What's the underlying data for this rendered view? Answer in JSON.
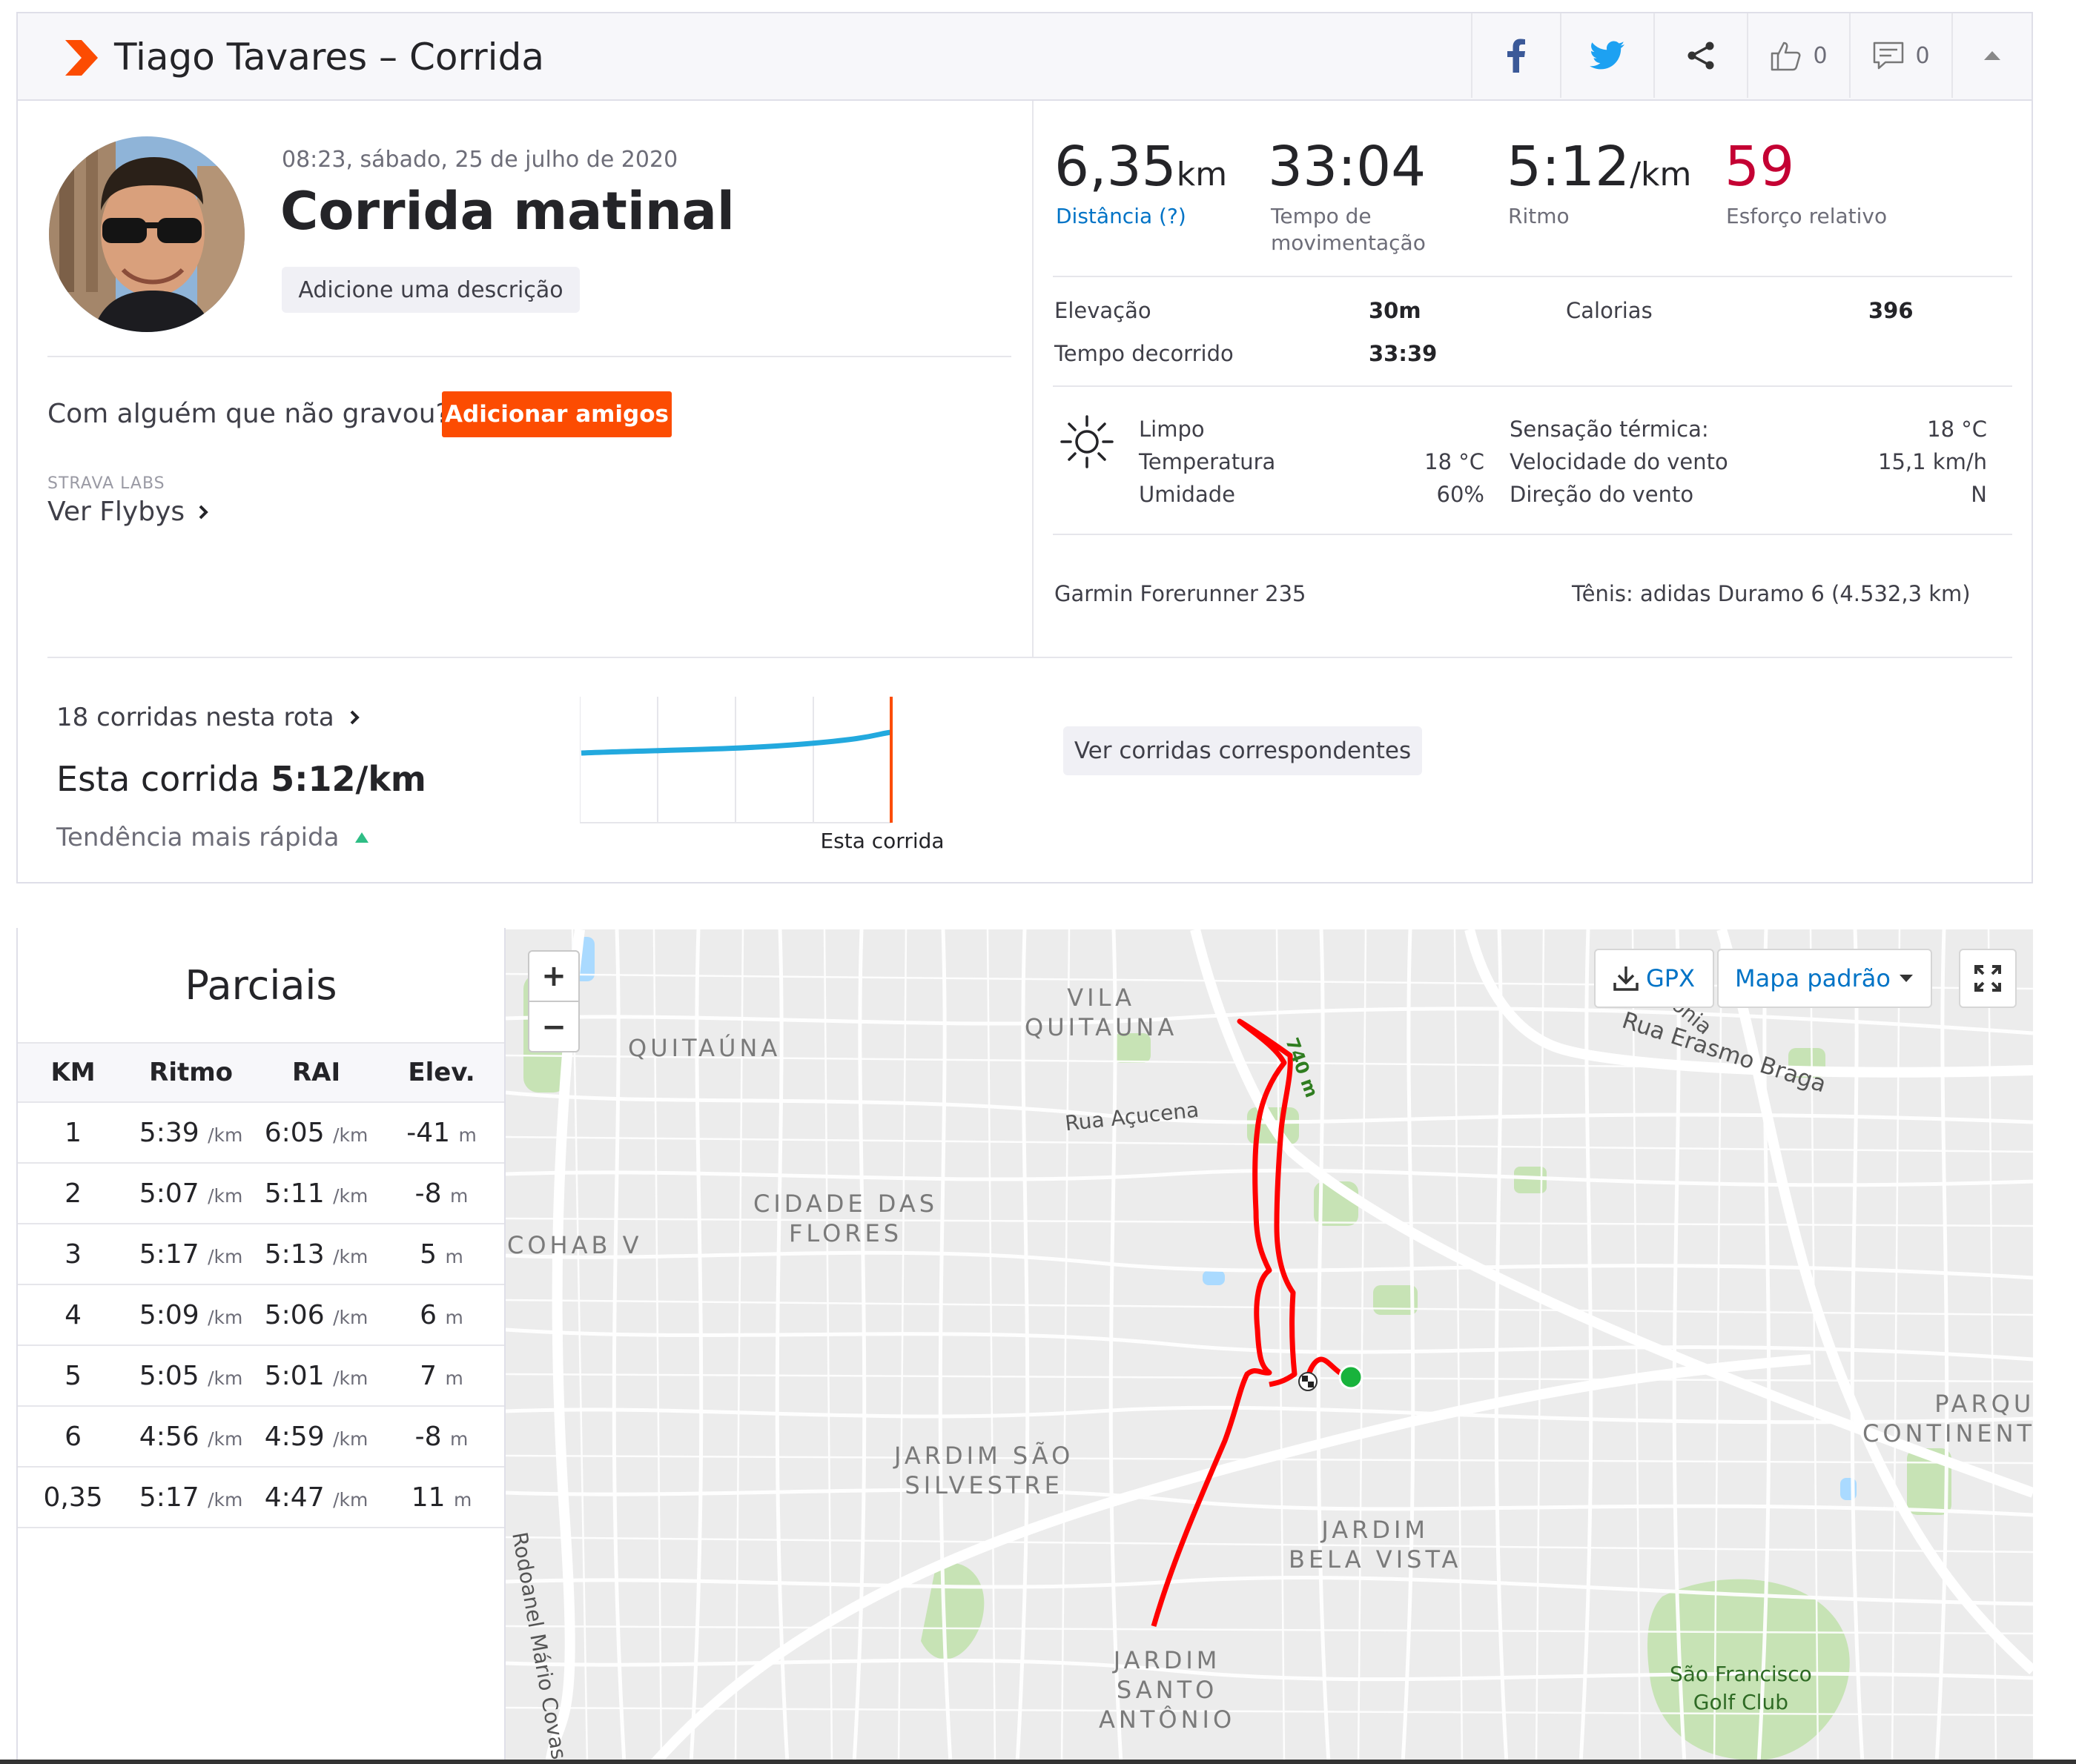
{
  "header": {
    "title": "Tiago Tavares – Corrida",
    "like_count": "0",
    "comment_count": "0",
    "brand_color": "#fc4c02"
  },
  "activity": {
    "datetime": "08:23, sábado, 25 de julho de 2020",
    "name": "Corrida matinal",
    "add_description": "Adicione uma descrição",
    "friends_question": "Com alguém que não gravou?",
    "add_friends": "Adicionar amigos",
    "labs_caption": "STRAVA LABS",
    "flybys": "Ver Flybys"
  },
  "stats": {
    "distance_value": "6,35",
    "distance_unit": "km",
    "distance_label": "Distância (?)",
    "moving_time_value": "33:04",
    "moving_time_label_1": "Tempo de",
    "moving_time_label_2": "movimentação",
    "pace_value": "5:12",
    "pace_unit": "/km",
    "pace_label": "Ritmo",
    "effort_value": "59",
    "effort_label": "Esforço relativo",
    "elevation_label": "Elevação",
    "elevation_value": "30m",
    "calories_label": "Calorias",
    "calories_value": "396",
    "elapsed_label": "Tempo decorrido",
    "elapsed_value": "33:39"
  },
  "weather": {
    "condition": "Limpo",
    "temperature_label": "Temperatura",
    "temperature_value": "18 °C",
    "humidity_label": "Umidade",
    "humidity_value": "60%",
    "feels_label": "Sensação térmica:",
    "feels_value": "18 °C",
    "wind_speed_label": "Velocidade do vento",
    "wind_speed_value": "15,1 km/h",
    "wind_dir_label": "Direção do vento",
    "wind_dir_value": "N"
  },
  "gear": {
    "device": "Garmin Forerunner 235",
    "shoes": "Tênis: adidas Duramo 6 (4.532,3 km)"
  },
  "trend": {
    "route_runs": "18 corridas nesta rota",
    "this_run_prefix": "Esta corrida",
    "this_run_pace": "5:12/km",
    "trend_text": "Tendência mais rápida",
    "chart_label": "Esta corrida",
    "match_button": "Ver corridas correspondentes"
  },
  "splits": {
    "title": "Parciais",
    "headers": [
      "KM",
      "Ritmo",
      "RAI",
      "Elev."
    ],
    "rows": [
      {
        "km": "1",
        "pace": "5:39",
        "gap": "6:05",
        "elev": "-41"
      },
      {
        "km": "2",
        "pace": "5:07",
        "gap": "5:11",
        "elev": "-8"
      },
      {
        "km": "3",
        "pace": "5:17",
        "gap": "5:13",
        "elev": "5"
      },
      {
        "km": "4",
        "pace": "5:09",
        "gap": "5:06",
        "elev": "6"
      },
      {
        "km": "5",
        "pace": "5:05",
        "gap": "5:01",
        "elev": "7"
      },
      {
        "km": "6",
        "pace": "4:56",
        "gap": "4:59",
        "elev": "-8"
      },
      {
        "km": "0,35",
        "pace": "5:17",
        "gap": "4:47",
        "elev": "11"
      }
    ],
    "pace_unit": "/km",
    "elev_unit": "m"
  },
  "map": {
    "zoom_in": "+",
    "zoom_out": "−",
    "gpx": "GPX",
    "map_type": "Mapa padrão",
    "route_color": "#ff0000",
    "distance_marker": "740 m",
    "labels": {
      "vila_quitauna": "VILA\nQUITAUNA",
      "quitauna": "QUITAÚNA",
      "cidade_das_flores": "CIDADE DAS\nFLORES",
      "cohab": "COHAB V",
      "jardim_sao_silvestre": "JARDIM SÃO\nSILVESTRE",
      "jardim_bela_vista": "JARDIM\nBELA VISTA",
      "jardim_santo_antonio": "JARDIM\nSANTO\nANTÔNIO",
      "parque_continental": "PARQUE\nCONTINENTA",
      "golf_club": "São Francisco\nGolf Club"
    },
    "streets": {
      "rua_acucena": "Rua Açucena",
      "rua_erasmo_braga": "Rua Erasmo Braga",
      "rodoanel": "Rodoanel Mário Covas",
      "partial": "ônia"
    }
  }
}
